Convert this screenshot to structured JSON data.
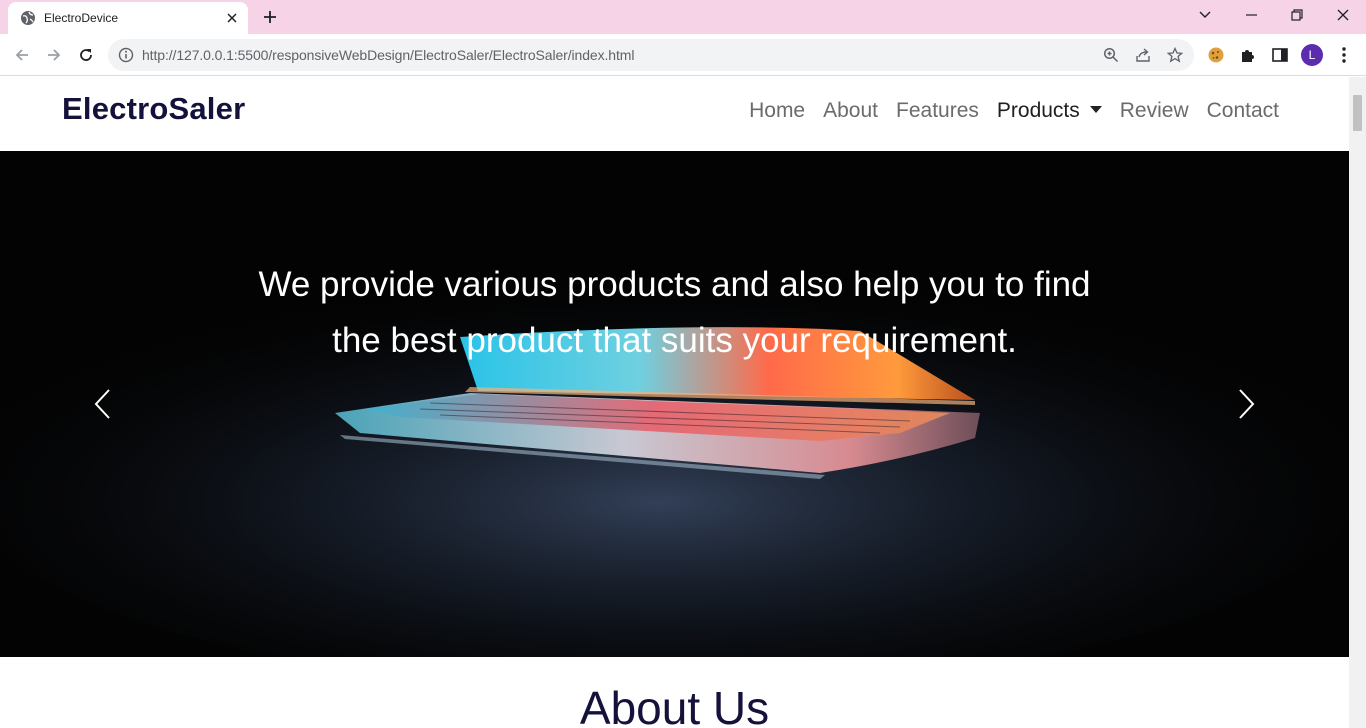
{
  "browser": {
    "tab_title": "ElectroDevice",
    "url": "http://127.0.0.1:5500/responsiveWebDesign/ElectroSaler/ElectroSaler/index.html",
    "profile_initial": "L"
  },
  "site": {
    "brand": "ElectroSaler",
    "nav": {
      "home": "Home",
      "about": "About",
      "features": "Features",
      "products": "Products",
      "review": "Review",
      "contact": "Contact"
    },
    "hero": {
      "line1": "We provide various products and also help you to find",
      "line2": "the best product that suits your requirement."
    },
    "about_title": "About Us"
  },
  "colors": {
    "tabstrip": "#f6d3e6",
    "brand_text": "#14123a",
    "avatar": "#5b2cb0"
  }
}
